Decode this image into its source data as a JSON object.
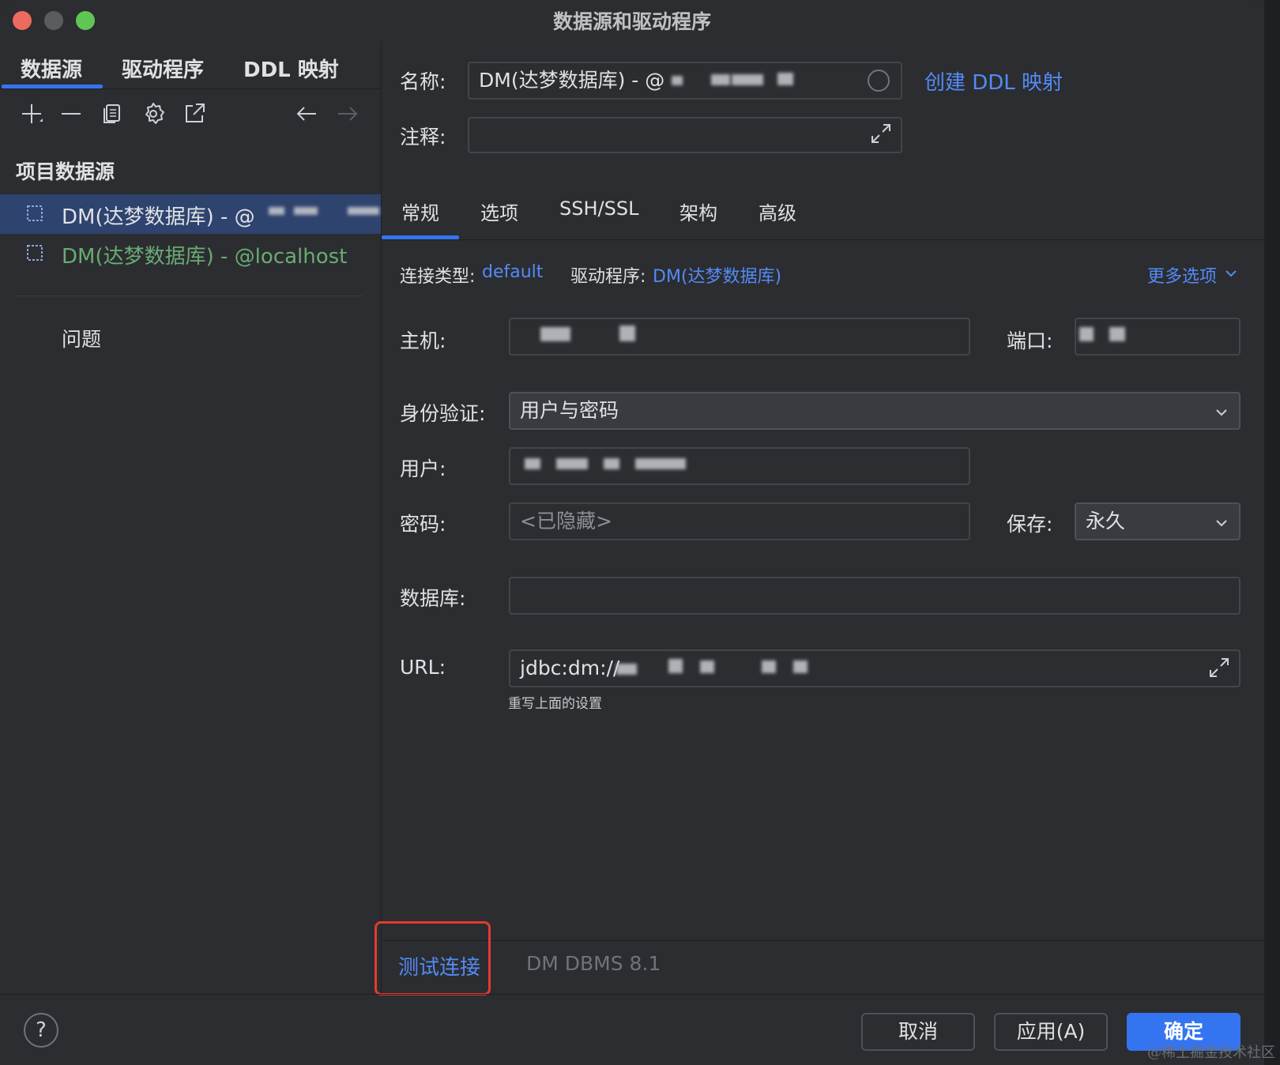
{
  "window": {
    "title": "数据源和驱动程序",
    "traffic_lights": {
      "close": "#ed6a5e",
      "minimize": "#5a5c60",
      "maximize": "#61c554"
    }
  },
  "left": {
    "tabs": [
      "数据源",
      "驱动程序",
      "DDL 映射"
    ],
    "toolbar_icons": [
      "add-icon",
      "remove-icon",
      "copy-icon",
      "gear-icon",
      "export-icon",
      "back-arrow-icon",
      "forward-arrow-icon"
    ],
    "section_title": "项目数据源",
    "datasources": [
      {
        "label": "DM(达梦数据库) - @",
        "selected": true,
        "color": "#dfe1e5"
      },
      {
        "label": "DM(达梦数据库) - @localhost",
        "selected": false,
        "color": "#6aab73"
      }
    ],
    "problems_label": "问题"
  },
  "header": {
    "name_label": "名称:",
    "name_value": "DM(达梦数据库) - @",
    "create_ddl_link": "创建 DDL 映射",
    "comment_label": "注释:",
    "comment_value": ""
  },
  "tabs": [
    "常规",
    "选项",
    "SSH/SSL",
    "架构",
    "高级"
  ],
  "general": {
    "conn_type_label": "连接类型:",
    "conn_type_value": "default",
    "driver_label": "驱动程序:",
    "driver_value": "DM(达梦数据库)",
    "more_options": "更多选项",
    "host_label": "主机:",
    "port_label": "端口:",
    "auth_label": "身份验证:",
    "auth_value": "用户与密码",
    "user_label": "用户:",
    "password_label": "密码:",
    "password_placeholder": "<已隐藏>",
    "save_label": "保存:",
    "save_value": "永久",
    "database_label": "数据库:",
    "database_value": "",
    "url_label": "URL:",
    "url_value": "jdbc:dm://",
    "url_hint": "重写上面的设置"
  },
  "status": {
    "test_connection": "测试连接",
    "dbms_version": "DM DBMS 8.1"
  },
  "footer": {
    "help": "?",
    "cancel": "取消",
    "apply": "应用(A)",
    "ok": "确定"
  },
  "watermark": "@稀土掘金技术社区"
}
